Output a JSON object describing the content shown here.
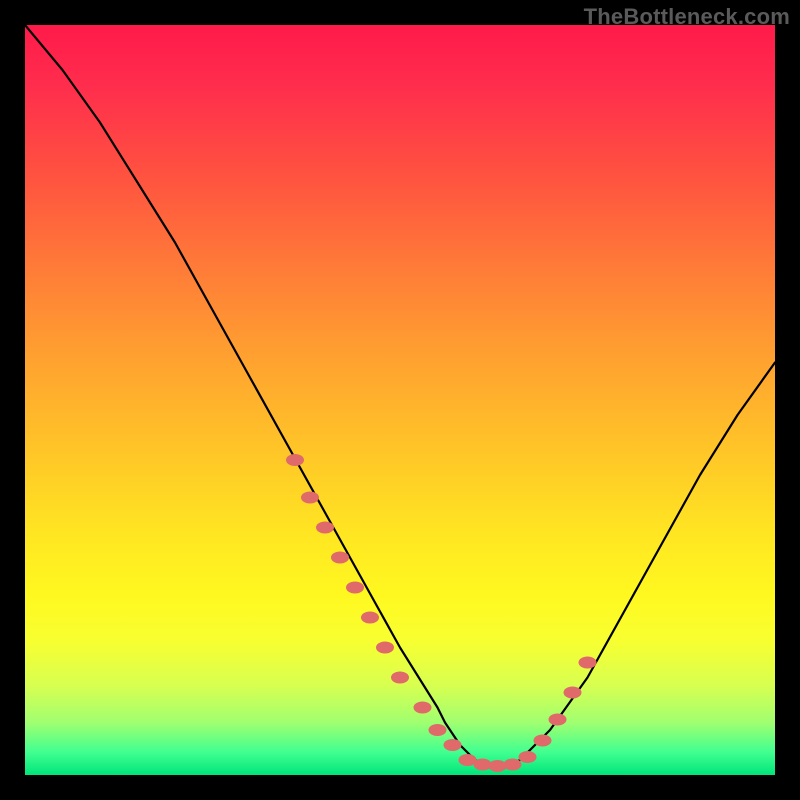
{
  "watermark": "TheBottleneck.com",
  "chart_data": {
    "type": "line",
    "title": "",
    "xlabel": "",
    "ylabel": "",
    "xlim": [
      0,
      100
    ],
    "ylim": [
      0,
      100
    ],
    "series": [
      {
        "name": "bottleneck-curve",
        "x": [
          0,
          5,
          10,
          15,
          20,
          25,
          30,
          35,
          40,
          45,
          50,
          55,
          56,
          58,
          60,
          62,
          64,
          66,
          70,
          75,
          80,
          85,
          90,
          95,
          100
        ],
        "values": [
          100,
          94,
          87,
          79,
          71,
          62,
          53,
          44,
          35,
          26,
          17,
          9,
          7,
          4,
          2,
          1,
          1,
          2,
          6,
          13,
          22,
          31,
          40,
          48,
          55
        ]
      }
    ],
    "highlight_points": {
      "name": "marker-dots",
      "color": "#e06a6a",
      "x": [
        36,
        38,
        40,
        42,
        44,
        46,
        48,
        50,
        53,
        55,
        57,
        59,
        61,
        63,
        65,
        67,
        69,
        71,
        73,
        75
      ],
      "values": [
        42,
        37,
        33,
        29,
        25,
        21,
        17,
        13,
        9,
        6,
        4,
        2,
        1.4,
        1.2,
        1.4,
        2.4,
        4.6,
        7.4,
        11,
        15
      ]
    },
    "gradient_stops": [
      {
        "pos": 0,
        "color": "#ff1a4a"
      },
      {
        "pos": 20,
        "color": "#ff5240"
      },
      {
        "pos": 44,
        "color": "#ffa030"
      },
      {
        "pos": 68,
        "color": "#ffe622"
      },
      {
        "pos": 88,
        "color": "#d8ff50"
      },
      {
        "pos": 100,
        "color": "#00e57a"
      }
    ]
  }
}
